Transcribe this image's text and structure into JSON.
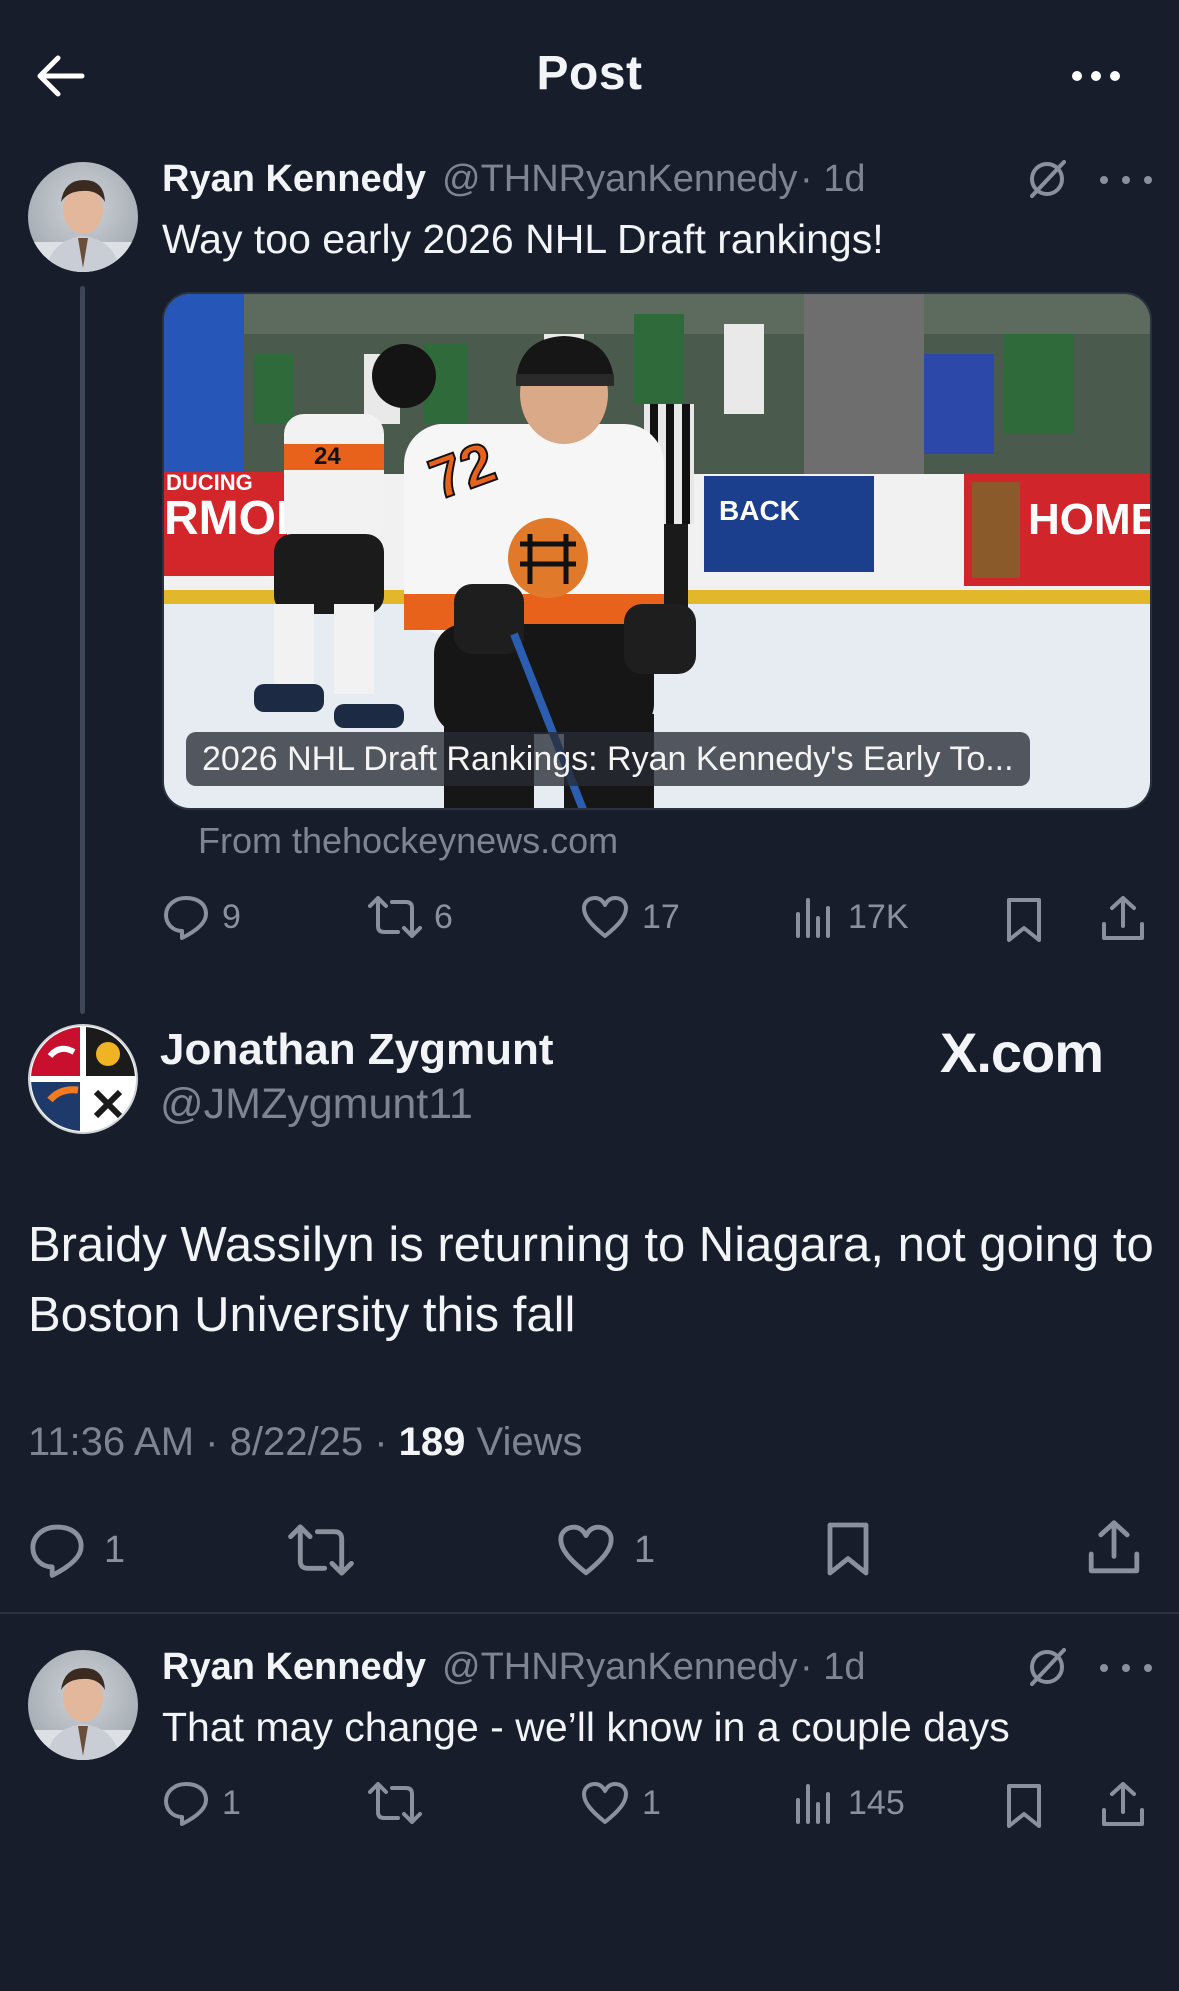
{
  "header": {
    "title": "Post"
  },
  "quoted_tweet": {
    "author_name": "Ryan Kennedy",
    "author_handle": "@THNRyanKennedy",
    "time": "· 1d",
    "text": "Way too early 2026 NHL Draft rankings!",
    "card_caption": "2026 NHL Draft Rankings: Ryan Kennedy's Early To...",
    "card_source": "From thehockeynews.com",
    "stats": {
      "replies": "9",
      "reposts": "6",
      "likes": "17",
      "views": "17K"
    }
  },
  "main_tweet": {
    "author_name": "Jonathan Zygmunt",
    "author_handle": "@JMZygmunt11",
    "watermark": "X.com",
    "text": "Braidy Wassilyn is returning to Niagara, not going to Boston University this fall",
    "time": "11:36 AM",
    "date": "8/22/25",
    "views_count": "189",
    "views_label": "Views",
    "stats": {
      "replies": "1",
      "likes": "1"
    }
  },
  "reply_tweet": {
    "author_name": "Ryan Kennedy",
    "author_handle": "@THNRyanKennedy",
    "time": "· 1d",
    "text": "That may change - we’ll know in a couple days",
    "stats": {
      "replies": "1",
      "likes": "1",
      "views": "145"
    }
  },
  "colors": {
    "background": "#171d2a",
    "text_primary": "#f2f4f7",
    "text_secondary": "#7d8593",
    "icon": "#8a919d"
  },
  "icons": {
    "back": "arrow-left-icon",
    "more": "more-horizontal-icon",
    "grok": "grok-icon",
    "reply": "reply-icon",
    "repost": "repost-icon",
    "like": "heart-icon",
    "views": "views-chart-icon",
    "bookmark": "bookmark-icon",
    "share": "share-icon"
  }
}
